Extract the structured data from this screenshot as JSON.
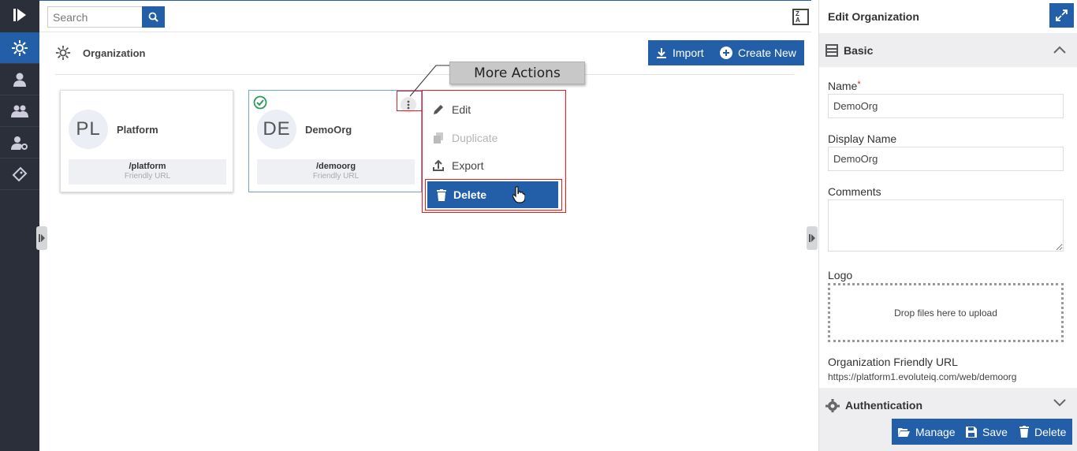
{
  "search": {
    "placeholder": "Search"
  },
  "header": {
    "title": "Organization",
    "import_label": "Import",
    "create_label": "Create New"
  },
  "cards": [
    {
      "initials": "PL",
      "name": "Platform",
      "url": "/platform",
      "url_label": "Friendly URL"
    },
    {
      "initials": "DE",
      "name": "DemoOrg",
      "url": "/demoorg",
      "url_label": "Friendly URL"
    }
  ],
  "tooltip": "More Actions",
  "menu": {
    "edit": "Edit",
    "duplicate": "Duplicate",
    "export": "Export",
    "delete": "Delete"
  },
  "sort": {
    "top": "Z",
    "bottom": "A"
  },
  "panel": {
    "title": "Edit Organization",
    "basic_label": "Basic",
    "name_label": "Name",
    "required_mark": "*",
    "name_value": "DemoOrg",
    "display_name_label": "Display Name",
    "display_name_value": "DemoOrg",
    "comments_label": "Comments",
    "logo_label": "Logo",
    "drop_text": "Drop files here to upload",
    "friendly_url_label": "Organization Friendly URL",
    "friendly_url_value": "https://platform1.evoluteiq.com/web/demoorg",
    "auth_label": "Authentication",
    "manage_label": "Manage",
    "save_label": "Save",
    "delete_label": "Delete"
  },
  "colors": {
    "accent": "#225fa8",
    "rail": "#2b2f3a",
    "highlight": "#e02020",
    "success": "#2e9a5a"
  }
}
